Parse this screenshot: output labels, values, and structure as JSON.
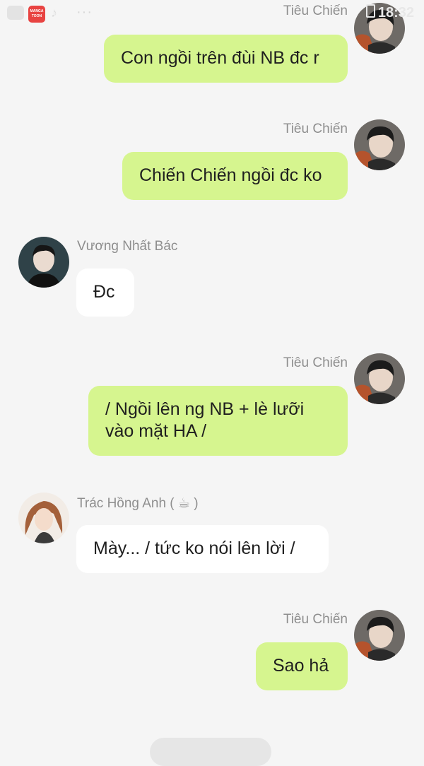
{
  "status_bar": {
    "app_icon_label": "MANGA TOON",
    "dots": "···",
    "clock": "18:32"
  },
  "messages": [
    {
      "sender": "Tiêu Chiến",
      "side": "right",
      "text": "Con ngồi trên đùi NB đc r"
    },
    {
      "sender": "Tiêu Chiến",
      "side": "right",
      "text": "Chiến Chiến ngồi đc ko"
    },
    {
      "sender": "Vương Nhất Bác",
      "side": "left",
      "text": "Đc"
    },
    {
      "sender": "Tiêu Chiến",
      "side": "right",
      "text_lines": [
        "/ Ngồi lên ng NB + lè lưỡi",
        "vào mặt HA /"
      ]
    },
    {
      "sender": "Trác Hồng Anh ( ☕ )",
      "side": "left",
      "text": "Mày... / tức ko nói lên lời /"
    },
    {
      "sender": "Tiêu Chiến",
      "side": "right",
      "text": "Sao hả"
    }
  ],
  "colors": {
    "background": "#f5f5f5",
    "outgoing_bubble": "#d6f58f",
    "incoming_bubble": "#ffffff",
    "sender_name": "#8e8e8e"
  }
}
